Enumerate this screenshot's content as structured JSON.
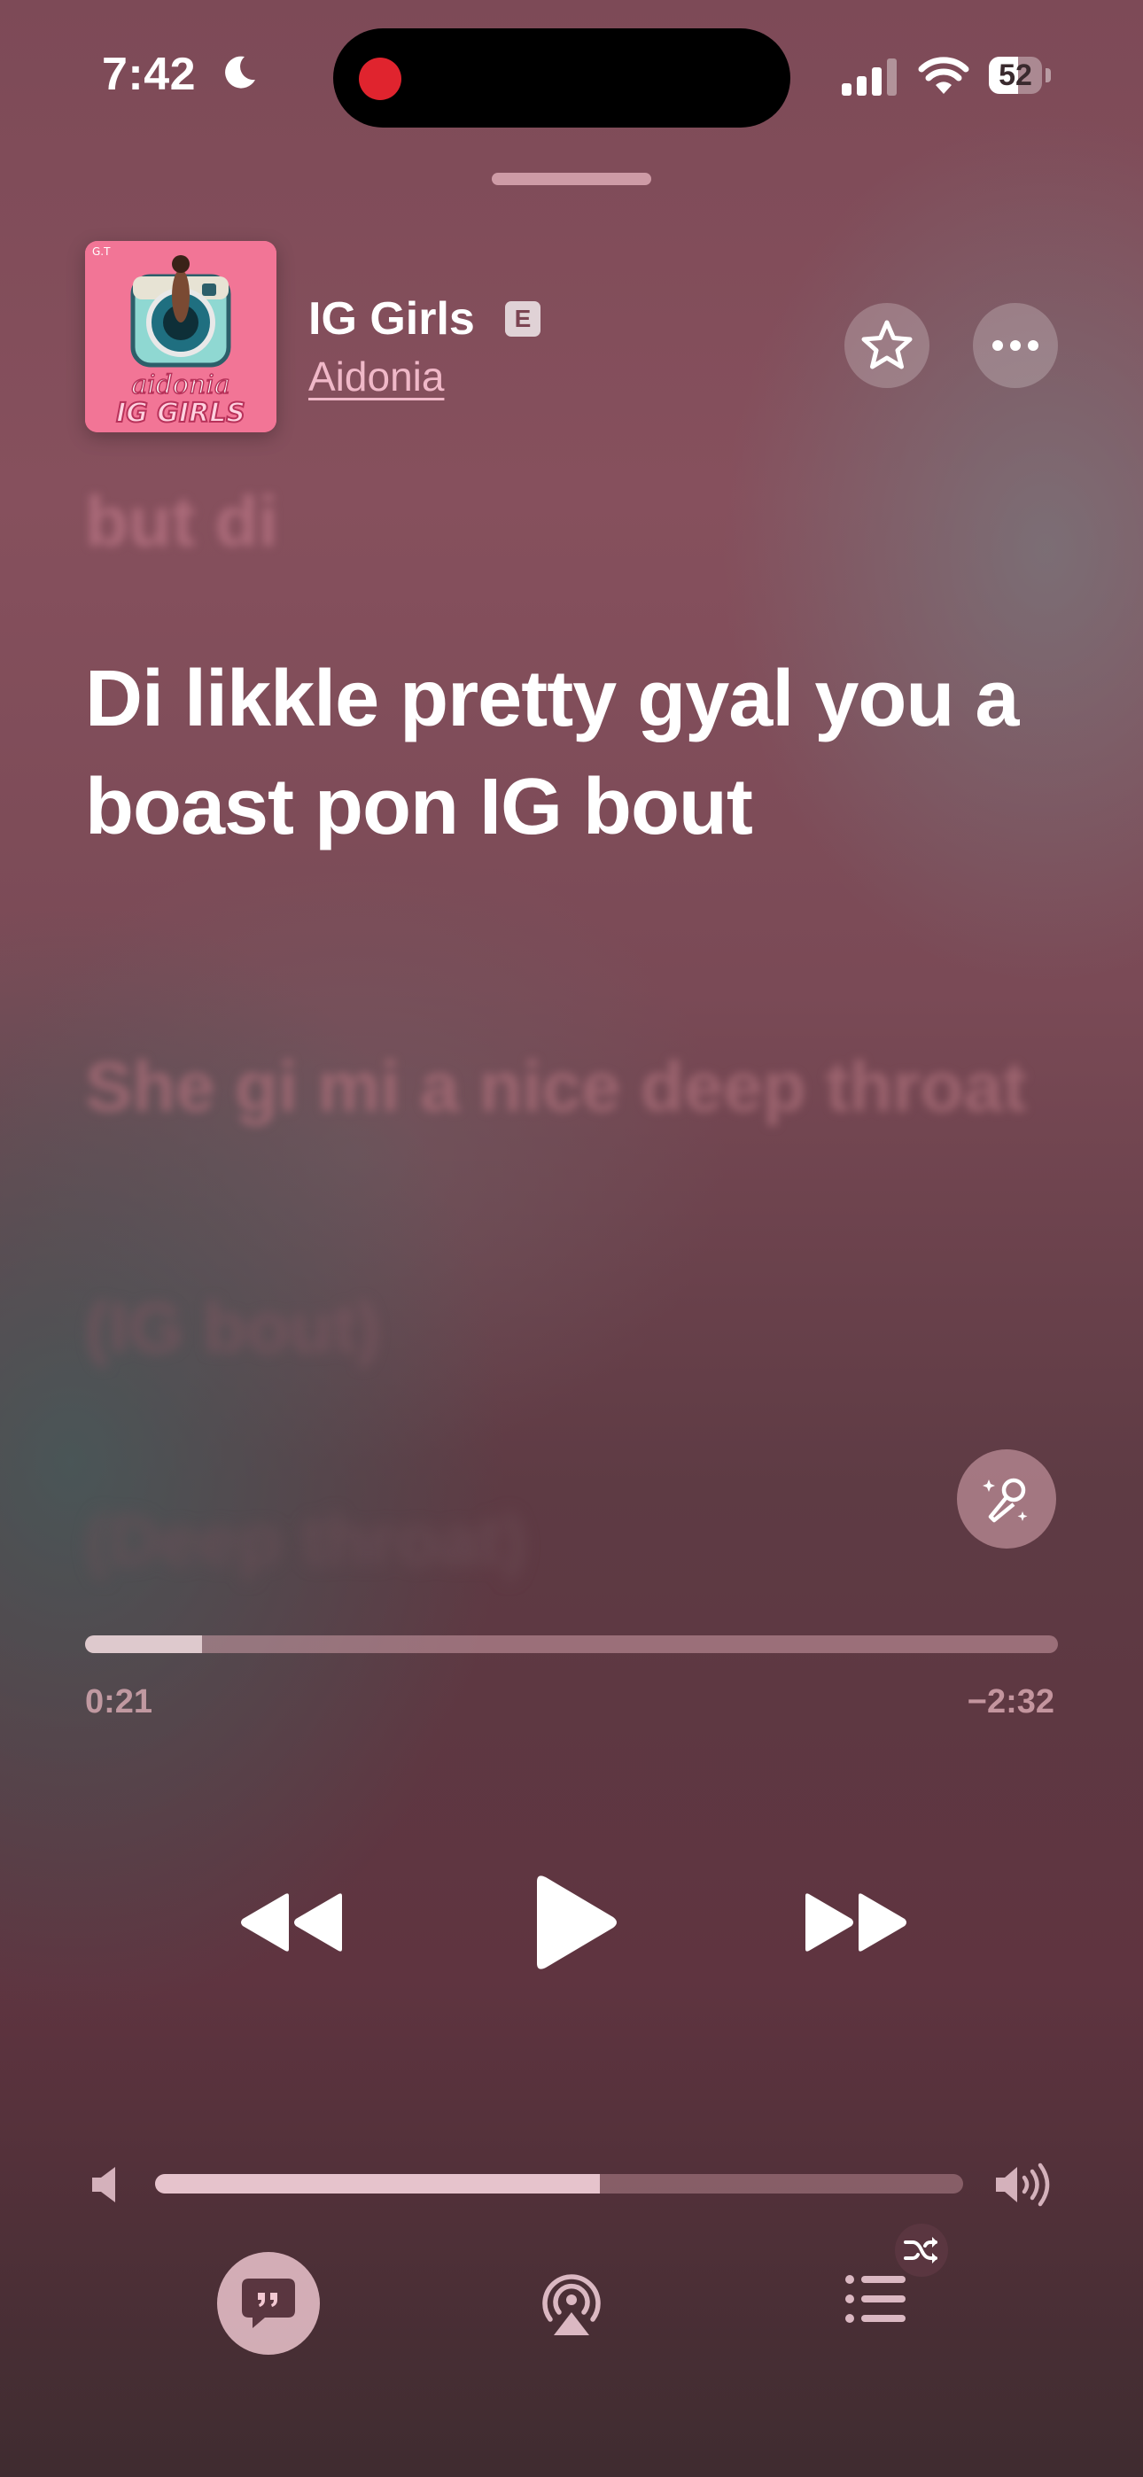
{
  "status_bar": {
    "time": "7:42",
    "battery": "52",
    "battery_level": 0.52
  },
  "now_playing": {
    "title": "IG Girls",
    "explicit_badge": "E",
    "artist": "Aidonia",
    "artwork_text": {
      "top": "aidonia",
      "bottom": "IG GIRLS",
      "corner": "G.T"
    }
  },
  "lyrics": {
    "previous": "but di",
    "active": "Di likkle pretty gyal you a boast pon IG bout",
    "next": [
      "She gi mi a nice deep throat",
      "(IG bout)",
      "(Deep throat)"
    ]
  },
  "playback": {
    "elapsed": "0:21",
    "remaining": "−2:32",
    "progress": 0.12,
    "volume": 0.55,
    "state": "paused"
  },
  "icons": {
    "favorite": "star-icon",
    "more": "ellipsis-icon",
    "sing": "microphone-sparkle-icon",
    "rewind": "rewind-icon",
    "play": "play-icon",
    "forward": "fast-forward-icon",
    "lyrics": "quote-bubble-icon",
    "airplay": "airplay-icon",
    "queue": "list-icon",
    "shuffle": "shuffle-icon"
  },
  "colors": {
    "accent_pink": "#f0b8c8",
    "record_dot": "#e0242e"
  }
}
